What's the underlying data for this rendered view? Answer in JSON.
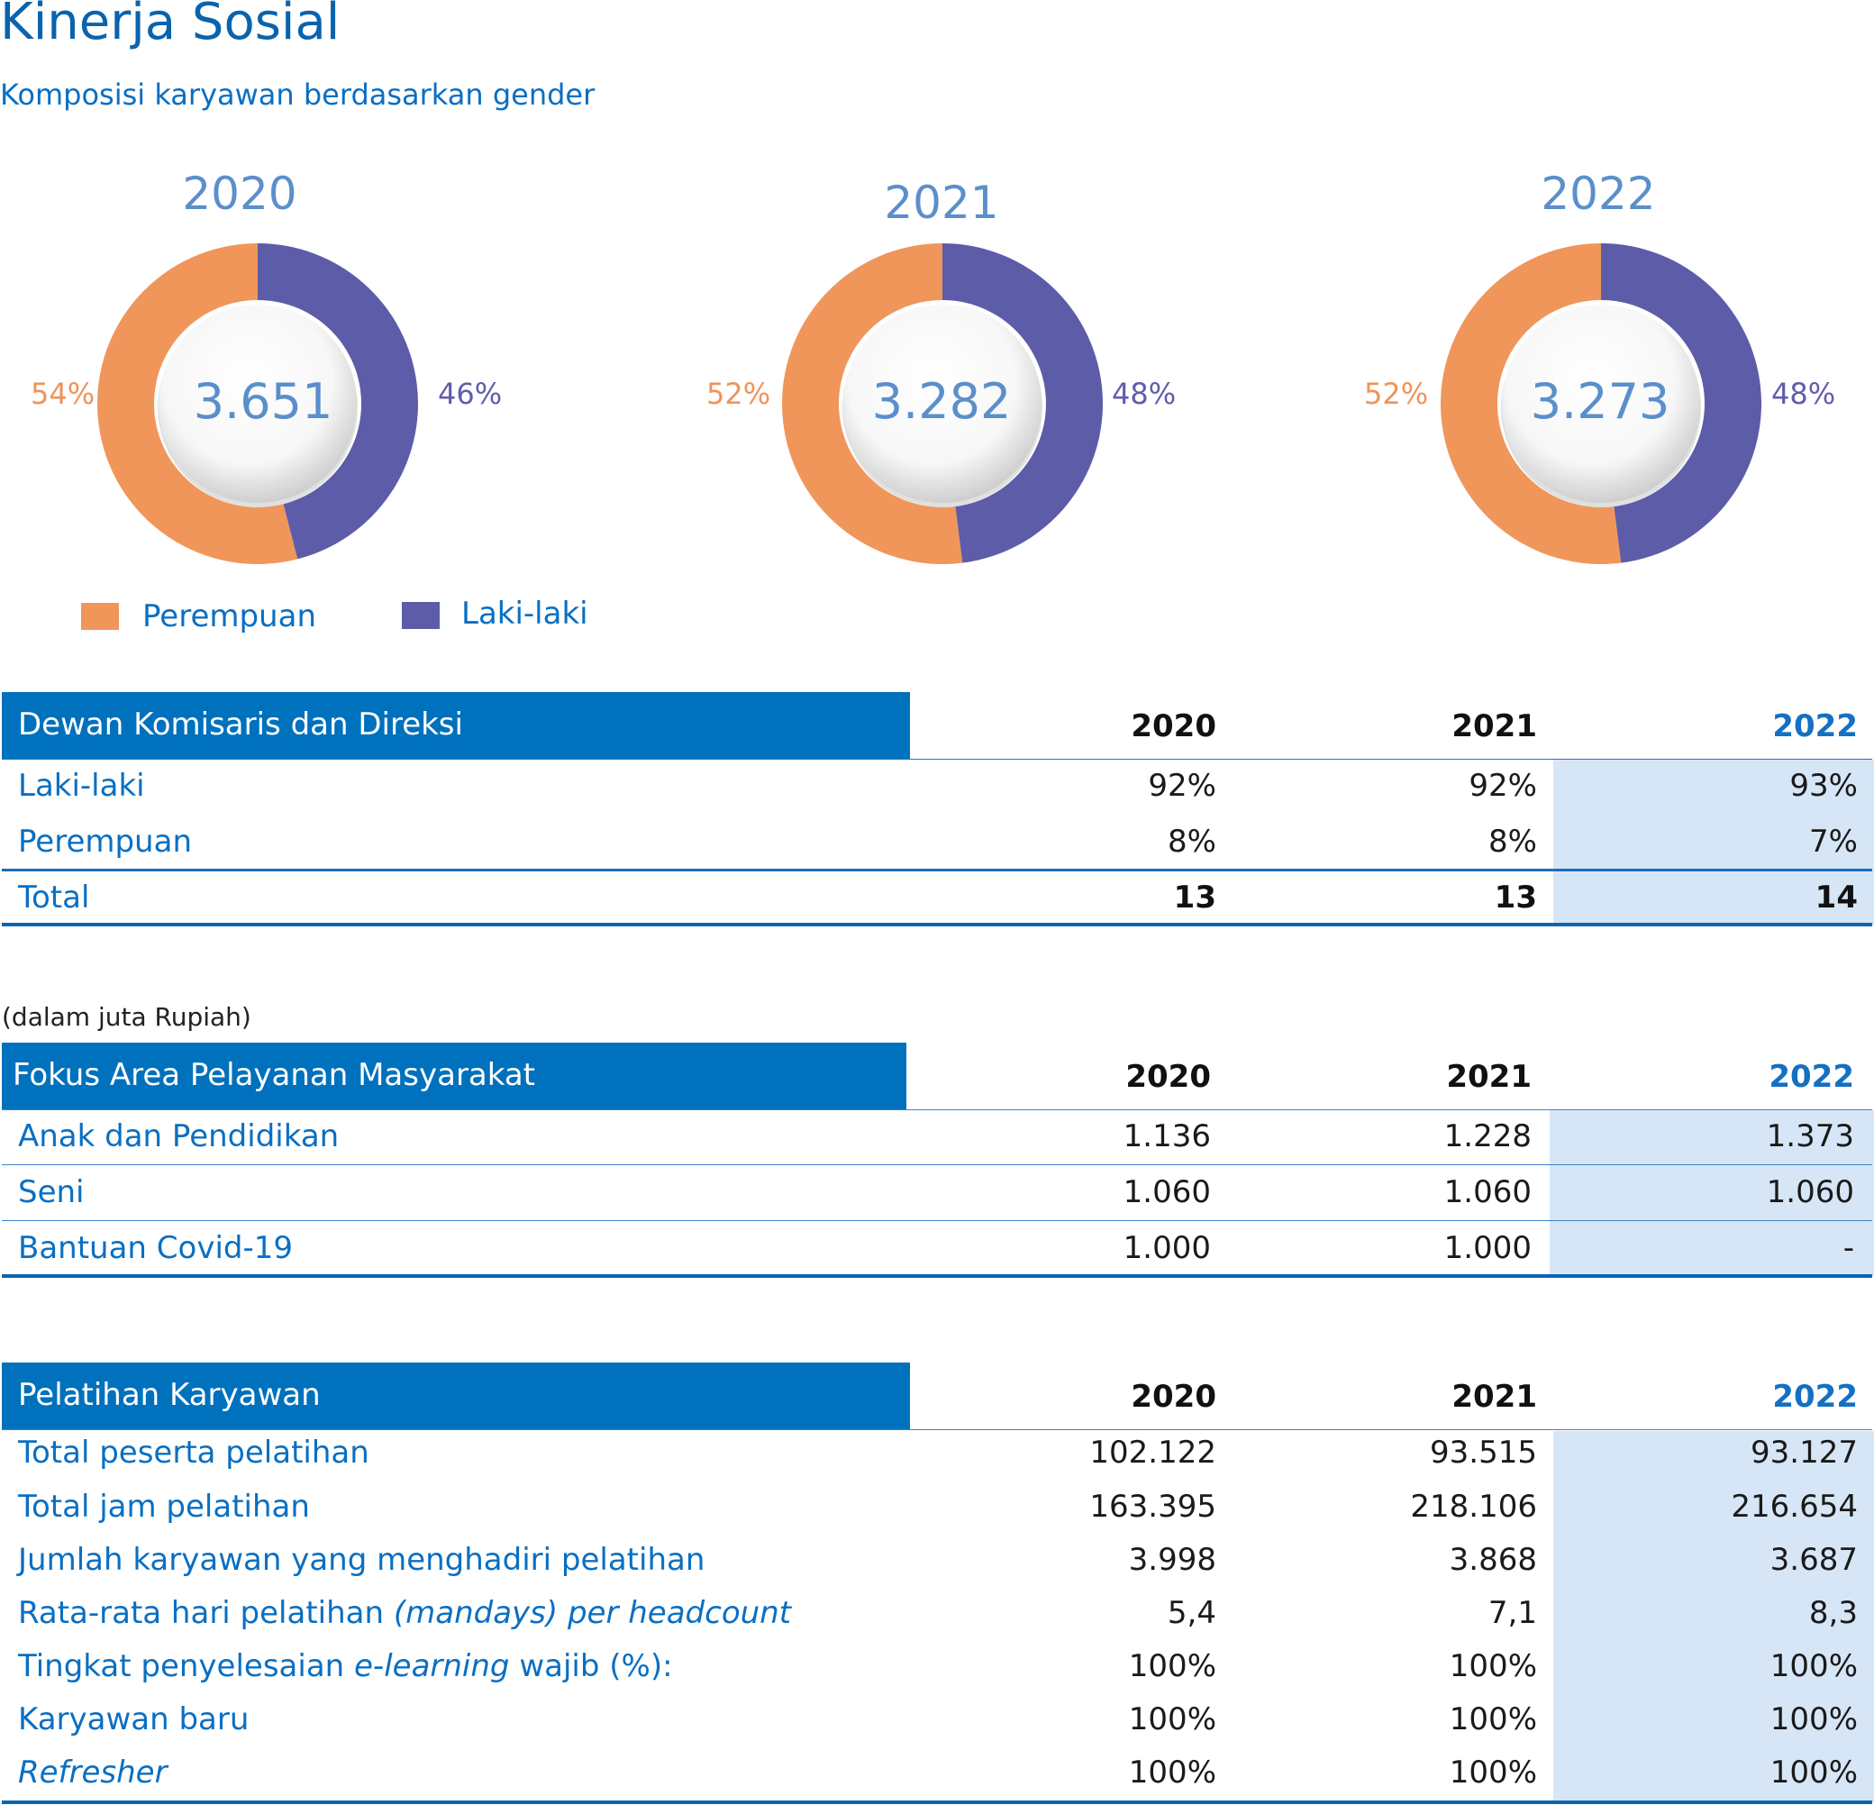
{
  "header": {
    "title": "Kinerja Sosial",
    "subtitle": "Komposisi karyawan berdasarkan gender"
  },
  "colors": {
    "perempuan": "#f0965a",
    "laki_laki": "#5d5ca8",
    "accent": "#0071bd",
    "highlight": "#d7e6f6"
  },
  "chart_data": [
    {
      "type": "pie",
      "title": "2020",
      "total": "3.651",
      "categories": [
        "Perempuan",
        "Laki-laki"
      ],
      "values": [
        54,
        46
      ],
      "labels": [
        "54%",
        "46%"
      ]
    },
    {
      "type": "pie",
      "title": "2021",
      "total": "3.282",
      "categories": [
        "Perempuan",
        "Laki-laki"
      ],
      "values": [
        52,
        48
      ],
      "labels": [
        "52%",
        "48%"
      ]
    },
    {
      "type": "pie",
      "title": "2022",
      "total": "3.273",
      "categories": [
        "Perempuan",
        "Laki-laki"
      ],
      "values": [
        52,
        48
      ],
      "labels": [
        "52%",
        "48%"
      ]
    }
  ],
  "legend": {
    "female": "Perempuan",
    "male": "Laki-laki"
  },
  "board": {
    "title": "Dewan Komisaris dan Direksi",
    "years": [
      "2020",
      "2021",
      "2022"
    ],
    "rows": [
      {
        "label": "Laki-laki",
        "values": [
          "92%",
          "92%",
          "93%"
        ]
      },
      {
        "label": "Perempuan",
        "values": [
          "8%",
          "8%",
          "7%"
        ]
      }
    ],
    "total": {
      "label": "Total",
      "values": [
        "13",
        "13",
        "14"
      ]
    }
  },
  "csr": {
    "note": "(dalam juta Rupiah)",
    "title": "Fokus Area Pelayanan Masyarakat",
    "years": [
      "2020",
      "2021",
      "2022"
    ],
    "rows": [
      {
        "label": "Anak dan Pendidikan",
        "values": [
          "1.136",
          "1.228",
          "1.373"
        ]
      },
      {
        "label": "Seni",
        "values": [
          "1.060",
          "1.060",
          "1.060"
        ]
      },
      {
        "label": "Bantuan Covid-19",
        "values": [
          "1.000",
          "1.000",
          "-"
        ]
      }
    ]
  },
  "training": {
    "title": "Pelatihan Karyawan",
    "years": [
      "2020",
      "2021",
      "2022"
    ],
    "rows": [
      {
        "label": "Total peserta pelatihan",
        "values": [
          "102.122",
          "93.515",
          "93.127"
        ]
      },
      {
        "label": "Total jam pelatihan",
        "values": [
          "163.395",
          "218.106",
          "216.654"
        ]
      },
      {
        "label": "Jumlah karyawan yang menghadiri pelatihan",
        "values": [
          "3.998",
          "3.868",
          "3.687"
        ]
      },
      {
        "label_a": "Rata-rata hari pelatihan ",
        "label_b": "(mandays) per headcount",
        "values": [
          "5,4",
          "7,1",
          "8,3"
        ]
      },
      {
        "label_a": "Tingkat penyelesaian ",
        "label_b": "e-learning",
        "label_c": " wajib (%):",
        "values": [
          "100%",
          "100%",
          "100%"
        ]
      },
      {
        "label": "Karyawan baru",
        "values": [
          "100%",
          "100%",
          "100%"
        ]
      },
      {
        "label_b": "Refresher",
        "values": [
          "100%",
          "100%",
          "100%"
        ]
      }
    ]
  }
}
